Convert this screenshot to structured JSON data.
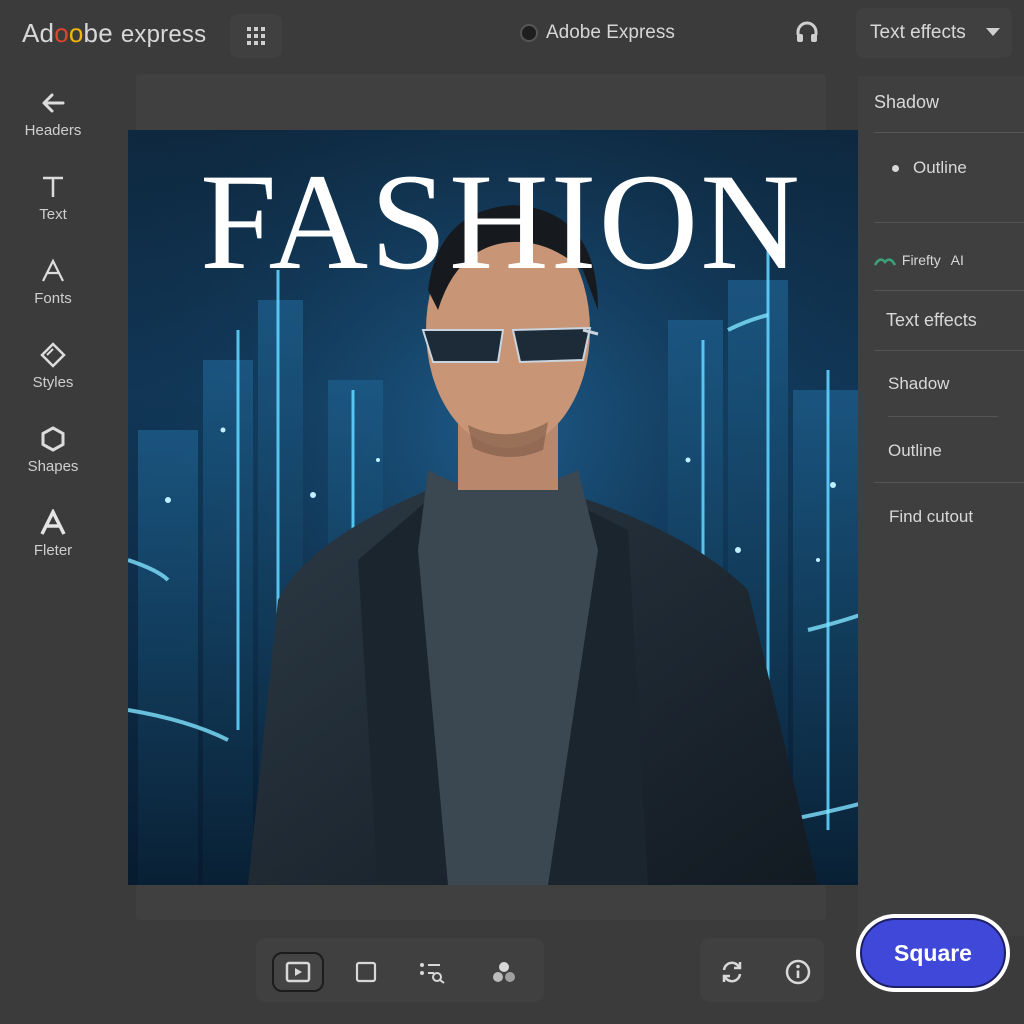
{
  "app": {
    "logo_prefix": "Ad",
    "logo_o1": "o",
    "logo_o2": "o",
    "logo_suffix": "be",
    "logo_product": "express",
    "title": "Adobe Express"
  },
  "header": {
    "dropdown_label": "Text effects"
  },
  "sidebar": {
    "items": [
      {
        "label": "Headers",
        "icon": "arrow-left-icon"
      },
      {
        "label": "Text",
        "icon": "text-icon"
      },
      {
        "label": "Fonts",
        "icon": "font-icon"
      },
      {
        "label": "Styles",
        "icon": "styles-icon"
      },
      {
        "label": "Shapes",
        "icon": "hexagon-icon"
      },
      {
        "label": "Fleter",
        "icon": "letter-a-icon"
      }
    ]
  },
  "canvas": {
    "headline": "FASHION"
  },
  "right_panel": {
    "items": [
      {
        "label": "Shadow"
      },
      {
        "label": "Outline"
      },
      {
        "label": "Firefty"
      },
      {
        "label": "AI"
      },
      {
        "label": "Text effects"
      },
      {
        "label": "Shadow"
      },
      {
        "label": "Outline"
      },
      {
        "label": "Find cutout"
      }
    ]
  },
  "bottom": {
    "square_label": "Square"
  },
  "colors": {
    "accent": "#3f48d8",
    "background": "#3b3b3b",
    "panel": "#404040"
  }
}
